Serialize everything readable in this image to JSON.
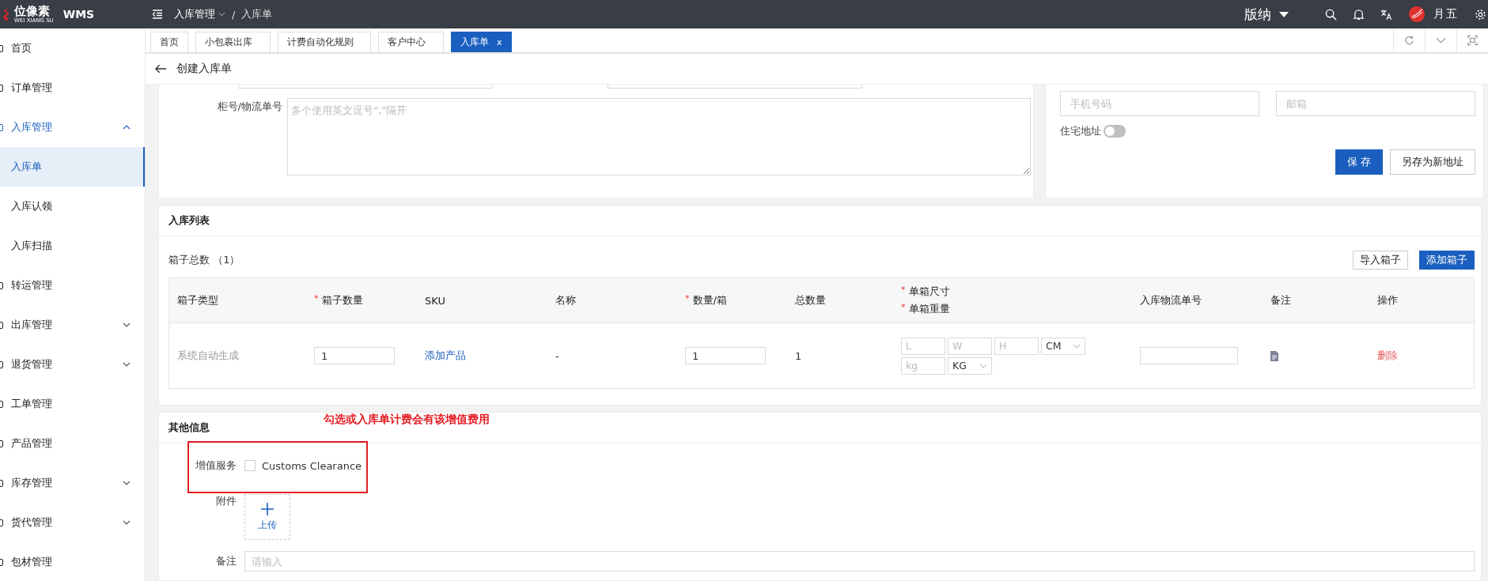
{
  "topbar": {
    "logo_text": "位像素",
    "logo_subtext": "WEI XIANG SU",
    "app_name": "WMS",
    "breadcrumb_separator": "/",
    "breadcrumb": [
      {
        "label": "入库管理",
        "kind": "menu"
      },
      {
        "label": "入库单",
        "kind": "page"
      }
    ],
    "warehouse": "版纳",
    "user": "月五"
  },
  "sidebar": {
    "items": [
      {
        "label": "首页",
        "kind": "page",
        "selected": false
      },
      {
        "label": "订单管理",
        "kind": "page",
        "selected": false
      },
      {
        "label": "入库管理",
        "kind": "group",
        "selected": true,
        "expanded": true,
        "children": [
          {
            "label": "入库单",
            "selected": true
          },
          {
            "label": "入库认领",
            "selected": false
          },
          {
            "label": "入库扫描",
            "selected": false
          }
        ]
      },
      {
        "label": "转运管理",
        "kind": "page",
        "selected": false
      },
      {
        "label": "出库管理",
        "kind": "group",
        "selected": false,
        "expanded": false
      },
      {
        "label": "退货管理",
        "kind": "group",
        "selected": false,
        "expanded": false
      },
      {
        "label": "工单管理",
        "kind": "page",
        "selected": false
      },
      {
        "label": "产品管理",
        "kind": "page",
        "selected": false
      },
      {
        "label": "库存管理",
        "kind": "group",
        "selected": false,
        "expanded": false
      },
      {
        "label": "货代管理",
        "kind": "group",
        "selected": false,
        "expanded": false
      },
      {
        "label": "包材管理",
        "kind": "page",
        "selected": false
      }
    ]
  },
  "tabs": [
    {
      "label": "首页",
      "selected": false
    },
    {
      "label": "小包裹出库",
      "selected": false
    },
    {
      "label": "计费自动化规则",
      "selected": false
    },
    {
      "label": "客户中心",
      "selected": false
    },
    {
      "label": "入库单",
      "selected": true,
      "close_label": "x"
    }
  ],
  "page_title": "创建入库单",
  "address_form": {
    "container_label": "柜号/物流单号",
    "container_placeholder": "多个使用英文逗号\",\"隔开",
    "phone_placeholder": "手机号码",
    "email_placeholder": "邮箱",
    "residential_label": "住宅地址",
    "residential_on": false,
    "buttons": [
      {
        "label": "保 存",
        "kind": "primary"
      },
      {
        "label": "另存为新地址",
        "kind": "default"
      }
    ]
  },
  "inbound_list": {
    "title": "入库列表",
    "box_total_label": "箱子总数",
    "box_total": "（1）",
    "required_mark": "*",
    "buttons": [
      {
        "label": "导入箱子",
        "kind": "default"
      },
      {
        "label": "添加箱子",
        "kind": "primary"
      }
    ],
    "columns": [
      {
        "label": "箱子类型",
        "required": false
      },
      {
        "label": "箱子数量",
        "required": true
      },
      {
        "label": "SKU",
        "required": false
      },
      {
        "label": "名称",
        "required": false
      },
      {
        "label": "数量/箱",
        "required": true
      },
      {
        "label": "总数量",
        "required": false
      },
      {
        "label": "单箱尺寸",
        "required": true,
        "second_label": "单箱重量",
        "second_required": true
      },
      {
        "label": "入库物流单号",
        "required": false
      },
      {
        "label": "备注",
        "required": false
      },
      {
        "label": "操作",
        "required": false
      }
    ],
    "rows": [
      {
        "box_type": "系统自动生成",
        "box_qty": "1",
        "sku_link": "添加产品",
        "name": "-",
        "qty_per_box": "1",
        "total": "1",
        "length_placeholder": "L",
        "width_placeholder": "W",
        "height_placeholder": "H",
        "size_unit": "CM",
        "weight_placeholder": "kg",
        "weight_unit": "KG",
        "action": "删除"
      }
    ]
  },
  "other_info": {
    "title": "其他信息",
    "value_added_label": "增值服务",
    "services": [
      {
        "label": "Customs Clearance",
        "checked": false
      }
    ],
    "attachment_label": "附件",
    "upload_label": "上传",
    "note_label": "备注",
    "note_placeholder": "请输入"
  },
  "annotation": {
    "text": "勾选或入库单计费会有该增值费用"
  }
}
